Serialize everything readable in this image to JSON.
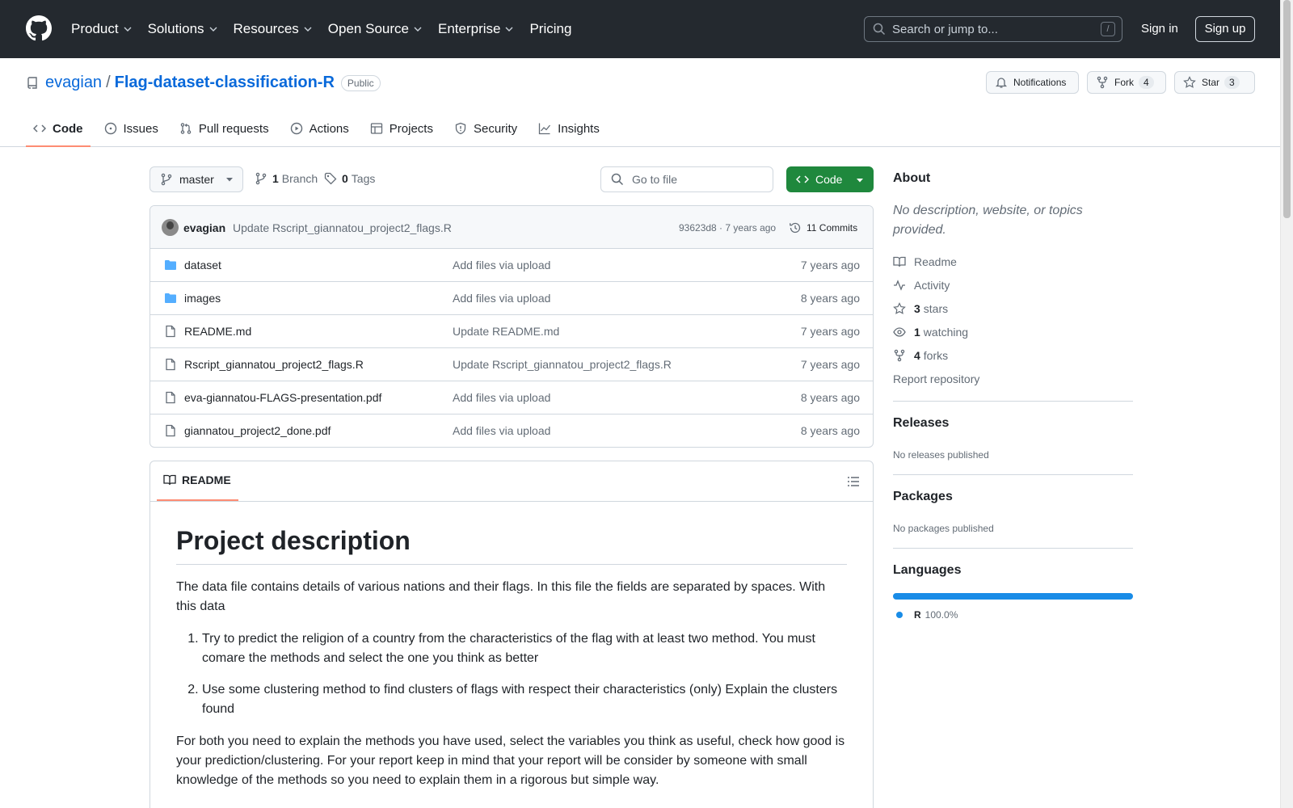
{
  "header": {
    "nav": [
      {
        "label": "Product",
        "dropdown": true
      },
      {
        "label": "Solutions",
        "dropdown": true
      },
      {
        "label": "Resources",
        "dropdown": true
      },
      {
        "label": "Open Source",
        "dropdown": true
      },
      {
        "label": "Enterprise",
        "dropdown": true
      },
      {
        "label": "Pricing",
        "dropdown": false
      }
    ],
    "search_placeholder": "Search or jump to...",
    "search_shortcut": "/",
    "signin": "Sign in",
    "signup": "Sign up"
  },
  "repo": {
    "owner": "evagian",
    "separator": "/",
    "name": "Flag-dataset-classification-R",
    "visibility": "Public",
    "notifications_label": "Notifications",
    "fork_label": "Fork",
    "fork_count": "4",
    "star_label": "Star",
    "star_count": "3",
    "tabs": [
      {
        "label": "Code",
        "icon": "code-icon",
        "active": true
      },
      {
        "label": "Issues",
        "icon": "issue-icon",
        "active": false
      },
      {
        "label": "Pull requests",
        "icon": "pull-request-icon",
        "active": false
      },
      {
        "label": "Actions",
        "icon": "play-icon",
        "active": false
      },
      {
        "label": "Projects",
        "icon": "table-icon",
        "active": false
      },
      {
        "label": "Security",
        "icon": "shield-icon",
        "active": false
      },
      {
        "label": "Insights",
        "icon": "graph-icon",
        "active": false
      }
    ]
  },
  "toolbar": {
    "branch": "master",
    "branch_count": "1",
    "branch_label": "Branch",
    "tag_count": "0",
    "tag_label": "Tags",
    "go_to_file": "Go to file",
    "code_button": "Code"
  },
  "commit": {
    "author": "evagian",
    "message": "Update Rscript_giannatou_project2_flags.R",
    "meta": "93623d8 · 7 years ago",
    "commits_label": "11 Commits"
  },
  "files": [
    {
      "type": "dir",
      "name": "dataset",
      "message": "Add files via upload",
      "age": "7 years ago"
    },
    {
      "type": "dir",
      "name": "images",
      "message": "Add files via upload",
      "age": "8 years ago"
    },
    {
      "type": "file",
      "name": "README.md",
      "message": "Update README.md",
      "age": "7 years ago"
    },
    {
      "type": "file",
      "name": "Rscript_giannatou_project2_flags.R",
      "message": "Update Rscript_giannatou_project2_flags.R",
      "age": "7 years ago"
    },
    {
      "type": "file",
      "name": "eva-giannatou-FLAGS-presentation.pdf",
      "message": "Add files via upload",
      "age": "8 years ago"
    },
    {
      "type": "file",
      "name": "giannatou_project2_done.pdf",
      "message": "Add files via upload",
      "age": "8 years ago"
    }
  ],
  "readme": {
    "tab_label": "README",
    "title": "Project description",
    "intro": "The data file contains details of various nations and their flags. In this file the fields are separated by spaces. With this data",
    "items": [
      "Try to predict the religion of a country from the characteristics of the flag with at least two method. You must comare the methods and select the one you think as better",
      "Use some clustering method to find clusters of flags with respect their characteristics (only) Explain the clusters found"
    ],
    "outro": "For both you need to explain the methods you have used, select the variables you think as useful, check how good is your prediction/clustering. For your report keep in mind that your report will be consider by someone with small knowledge of the methods so you need to explain them in a rigorous but simple way."
  },
  "sidebar": {
    "about_title": "About",
    "about_desc": "No description, website, or topics provided.",
    "readme_link": "Readme",
    "activity_link": "Activity",
    "stars_count": "3",
    "stars_label": "stars",
    "watching_count": "1",
    "watching_label": "watching",
    "forks_count": "4",
    "forks_label": "forks",
    "report": "Report repository",
    "releases_title": "Releases",
    "releases_desc": "No releases published",
    "packages_title": "Packages",
    "packages_desc": "No packages published",
    "languages_title": "Languages",
    "language_name": "R",
    "language_pct": "100.0%",
    "language_color": "#198ce7",
    "language_share": 1.0
  },
  "colors": {
    "header_bg": "#24292f",
    "link": "#0969da",
    "green_button": "#1f883d",
    "tab_underline": "#fd8c73"
  }
}
